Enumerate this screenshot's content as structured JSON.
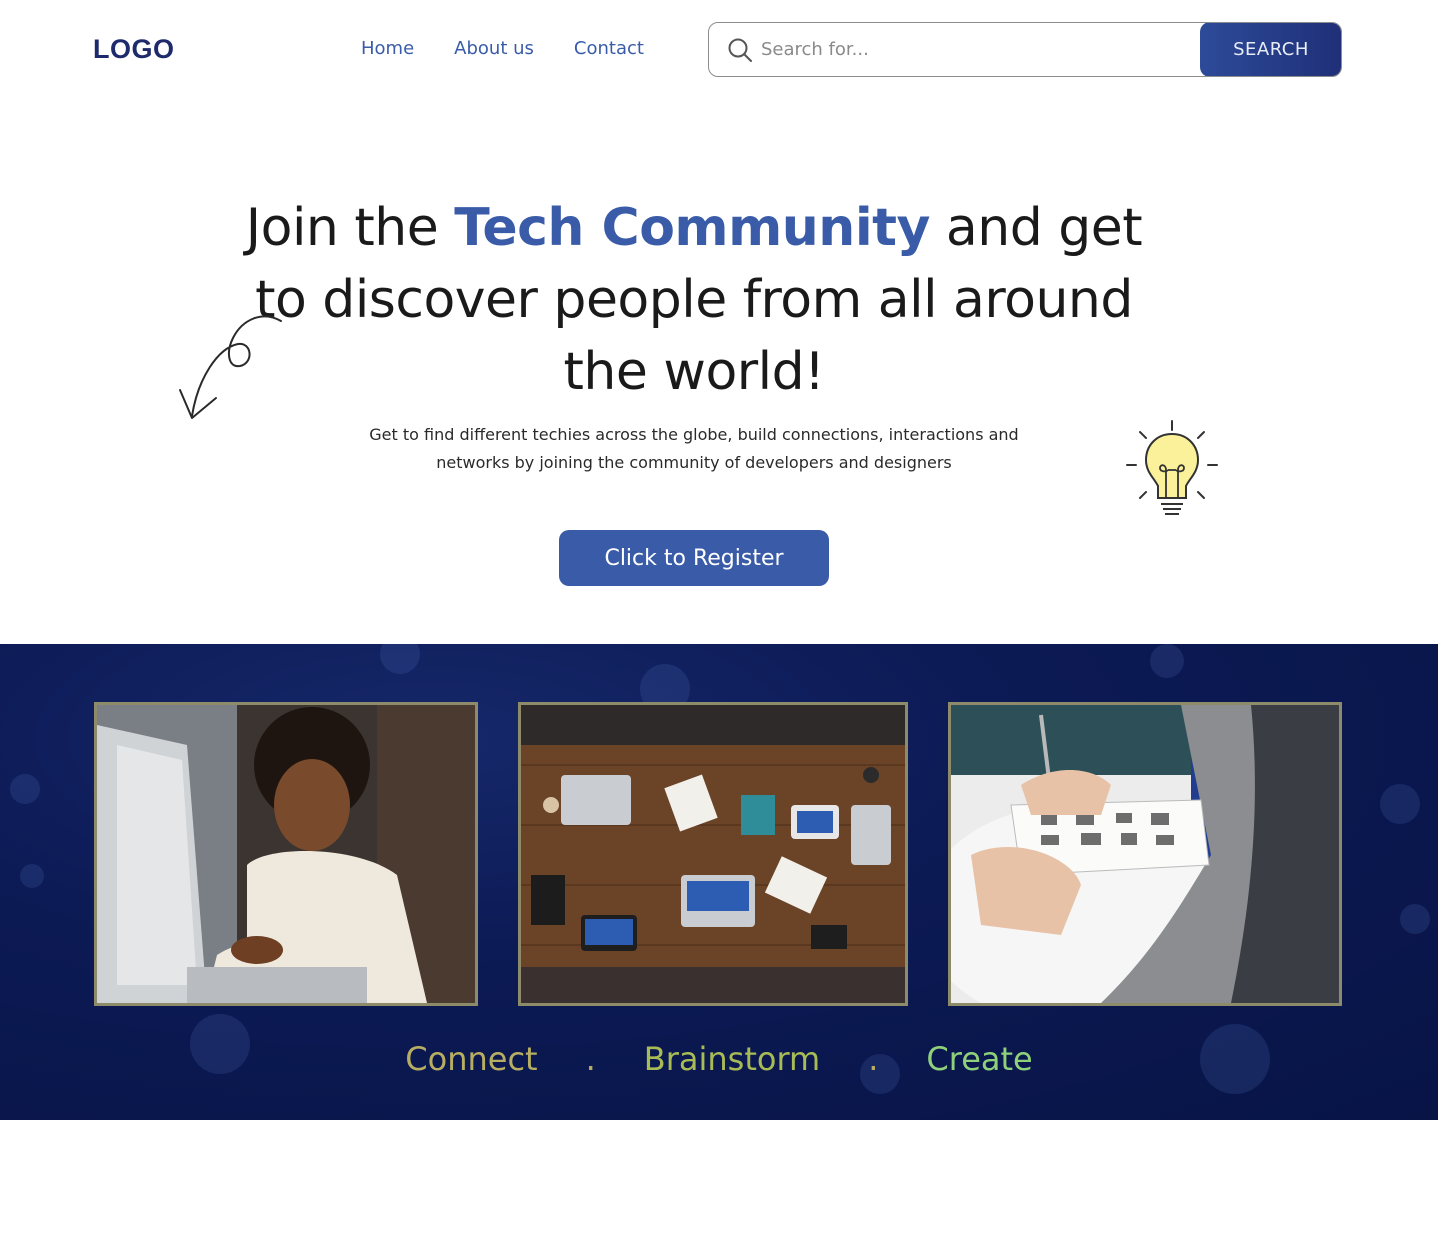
{
  "header": {
    "logo": "LOGO",
    "nav": [
      "Home",
      "About us",
      "Contact"
    ],
    "search": {
      "placeholder": "Search for...",
      "button": "SEARCH"
    }
  },
  "hero": {
    "title_pre": "Join the ",
    "title_highlight": "Tech Community",
    "title_post": " and get to discover people from all around the world!",
    "subtitle": "Get to find different techies across the globe, build connections, interactions and networks by joining the community of developers and designers",
    "cta": "Click to Register"
  },
  "band": {
    "photos": [
      "woman-laptop-photo",
      "team-table-photo",
      "sketching-logos-photo"
    ],
    "tagline": [
      "Connect",
      ".",
      "Brainstorm",
      ".",
      "Create"
    ]
  },
  "colors": {
    "brand": "#3a5ca8",
    "navy": "#1d2a6b",
    "band_bg": "#0c1a55"
  }
}
